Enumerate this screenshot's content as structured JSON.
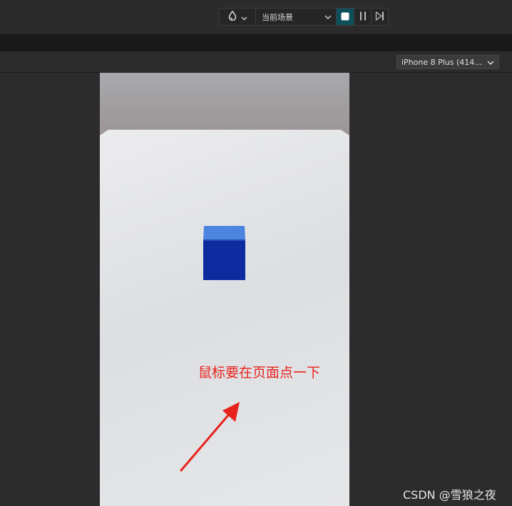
{
  "toolbar": {
    "engine_icon": "water-drop-icon",
    "scene_select": "当前场景",
    "buttons": [
      "stop-icon",
      "pause-icon",
      "step-icon"
    ]
  },
  "device": {
    "selected": "iPhone 8 Plus (414…"
  },
  "game": {
    "annotation": "鼠标要在页面点一下",
    "cube_colors": {
      "top": "#4c85e0",
      "front": "#0d2a9e"
    }
  },
  "watermark": "CSDN @雪狼之夜",
  "colors": {
    "accent_stop": "#0e4f5c",
    "annotation_red": "#e8231d"
  }
}
